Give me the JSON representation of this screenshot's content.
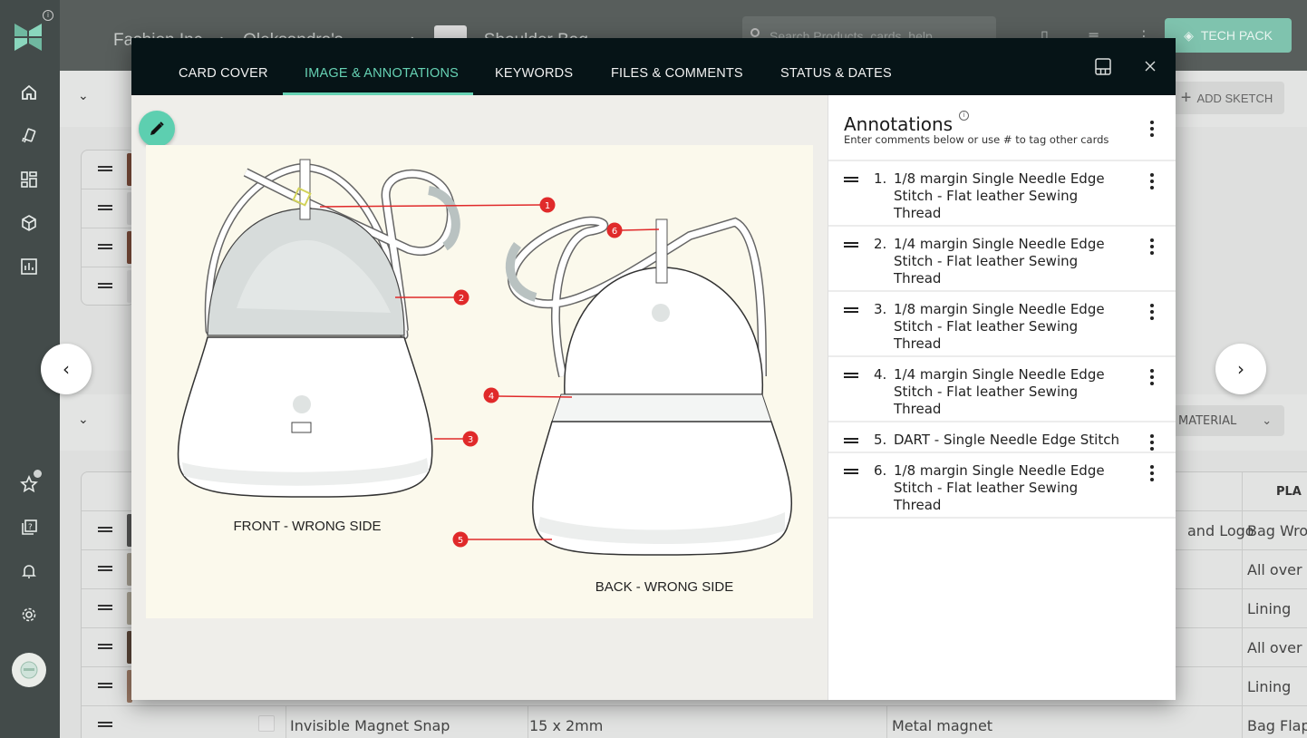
{
  "app": {
    "breadcrumb": [
      "Fashion Inc",
      "Oleksandra's",
      "Shoulder Bag"
    ],
    "search_placeholder": "Search Products, cards, help",
    "tech_pack_label": "TECH PACK",
    "add_sketch_label": "ADD SKETCH",
    "material_label": "MATERIAL",
    "accent_color": "#66d2b4"
  },
  "background_table": {
    "rows": [
      {
        "name": "",
        "size": "",
        "material": "and Logo",
        "placement": "Bag Wro"
      },
      {
        "name": "",
        "size": "",
        "material": "",
        "placement": "All over"
      },
      {
        "name": "",
        "size": "",
        "material": "",
        "placement": "Lining"
      },
      {
        "name": "",
        "size": "",
        "material": "",
        "placement": "All over"
      },
      {
        "name": "",
        "size": "",
        "material": "",
        "placement": "Lining"
      },
      {
        "name": "Invisible Magnet Snap",
        "size": "15 x 2mm",
        "material": "Metal magnet",
        "placement": "Bag Flap"
      }
    ],
    "placement_header": "PLA"
  },
  "modal": {
    "tabs": [
      {
        "label": "CARD COVER",
        "active": false
      },
      {
        "label": "IMAGE & ANNOTATIONS",
        "active": true
      },
      {
        "label": "KEYWORDS",
        "active": false
      },
      {
        "label": "FILES & COMMENTS",
        "active": false
      },
      {
        "label": "STATUS & DATES",
        "active": false
      }
    ],
    "sketch": {
      "front_label": "FRONT - WRONG SIDE",
      "back_label": "BACK - WRONG SIDE",
      "markers": [
        "1",
        "2",
        "3",
        "4",
        "5",
        "6"
      ]
    },
    "annotations": {
      "title": "Annotations",
      "subtitle": "Enter comments below or use # to tag other cards",
      "items": [
        {
          "num": "1.",
          "text": "1/8 margin Single Needle Edge Stitch - Flat leather Sewing Thread"
        },
        {
          "num": "2.",
          "text": "1/4 margin Single Needle Edge Stitch - Flat leather Sewing Thread"
        },
        {
          "num": "3.",
          "text": "1/8 margin Single Needle Edge Stitch - Flat leather Sewing Thread"
        },
        {
          "num": "4.",
          "text": "1/4 margin Single Needle Edge Stitch - Flat leather Sewing Thread"
        },
        {
          "num": "5.",
          "text": "DART - Single Needle Edge Stitch"
        },
        {
          "num": "6.",
          "text": "1/8 margin Single Needle Edge Stitch - Flat leather Sewing Thread"
        }
      ]
    }
  }
}
